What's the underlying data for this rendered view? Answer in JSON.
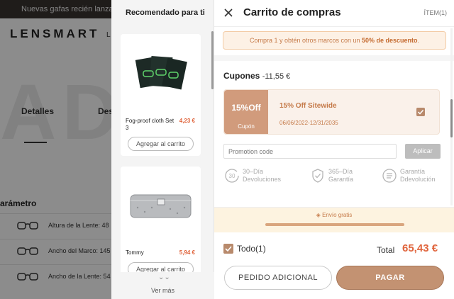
{
  "background": {
    "promo_text": "Nuevas gafas recién lanzadas",
    "logo": "LENSMART",
    "nav_fragment": "L",
    "hero_text": "AD",
    "tabs": [
      "Detalles",
      "Des"
    ],
    "section_title": "arámetro",
    "param_rows": [
      "Altura de la Lente: 48",
      "Ancho del Marco: 145",
      "Ancho de la Lente: 54"
    ]
  },
  "recommended": {
    "title": "Recomendado para ti",
    "products": [
      {
        "name": "Fog-proof cloth Set 3",
        "price": "4,23 €",
        "button": "Agregar al carrito",
        "image_icon": "cloth-packets-image"
      },
      {
        "name": "Tommy",
        "price": "5,94 €",
        "button": "Agregar al carrito",
        "image_icon": "glasses-case-image"
      }
    ],
    "see_more": "Ver más"
  },
  "cart": {
    "title": "Carrito de compras",
    "item_count": "ÍTEM(1)",
    "notice": {
      "prefix": "Compra 1 y obtén otros marcos con un ",
      "highlight": "50% de descuento",
      "suffix": "."
    },
    "coupons": {
      "label": "Cupones",
      "amount": "-11,55 €",
      "coupon": {
        "percent": "15%Off",
        "badge": "Cupón",
        "name": "15% Off Sitewide",
        "validity": "06/06/2022-12/31/2035",
        "checked": true
      }
    },
    "promo": {
      "placeholder": "Promotion code",
      "apply": "Aplicar"
    },
    "guarantees": [
      {
        "icon": "return-30-icon",
        "line1": "30–Día",
        "line2": "Devoluciones"
      },
      {
        "icon": "shield-icon",
        "line1": "365–Día",
        "line2": "Garantía"
      },
      {
        "icon": "money-back-icon",
        "line1": "Garantía",
        "line2": "Ddevolución"
      }
    ],
    "shipping": {
      "text": "Envío gratis",
      "progress": 1.0
    },
    "footer": {
      "select_all": "Todo(1)",
      "total_label": "Total",
      "total_value": "65,43 €",
      "extra_button": "PEDIDO ADICIONAL",
      "pay_button": "PAGAR"
    },
    "colors": {
      "accent": "#c39272",
      "price": "#e0643c",
      "notice_bg": "#fdf1e5"
    }
  }
}
